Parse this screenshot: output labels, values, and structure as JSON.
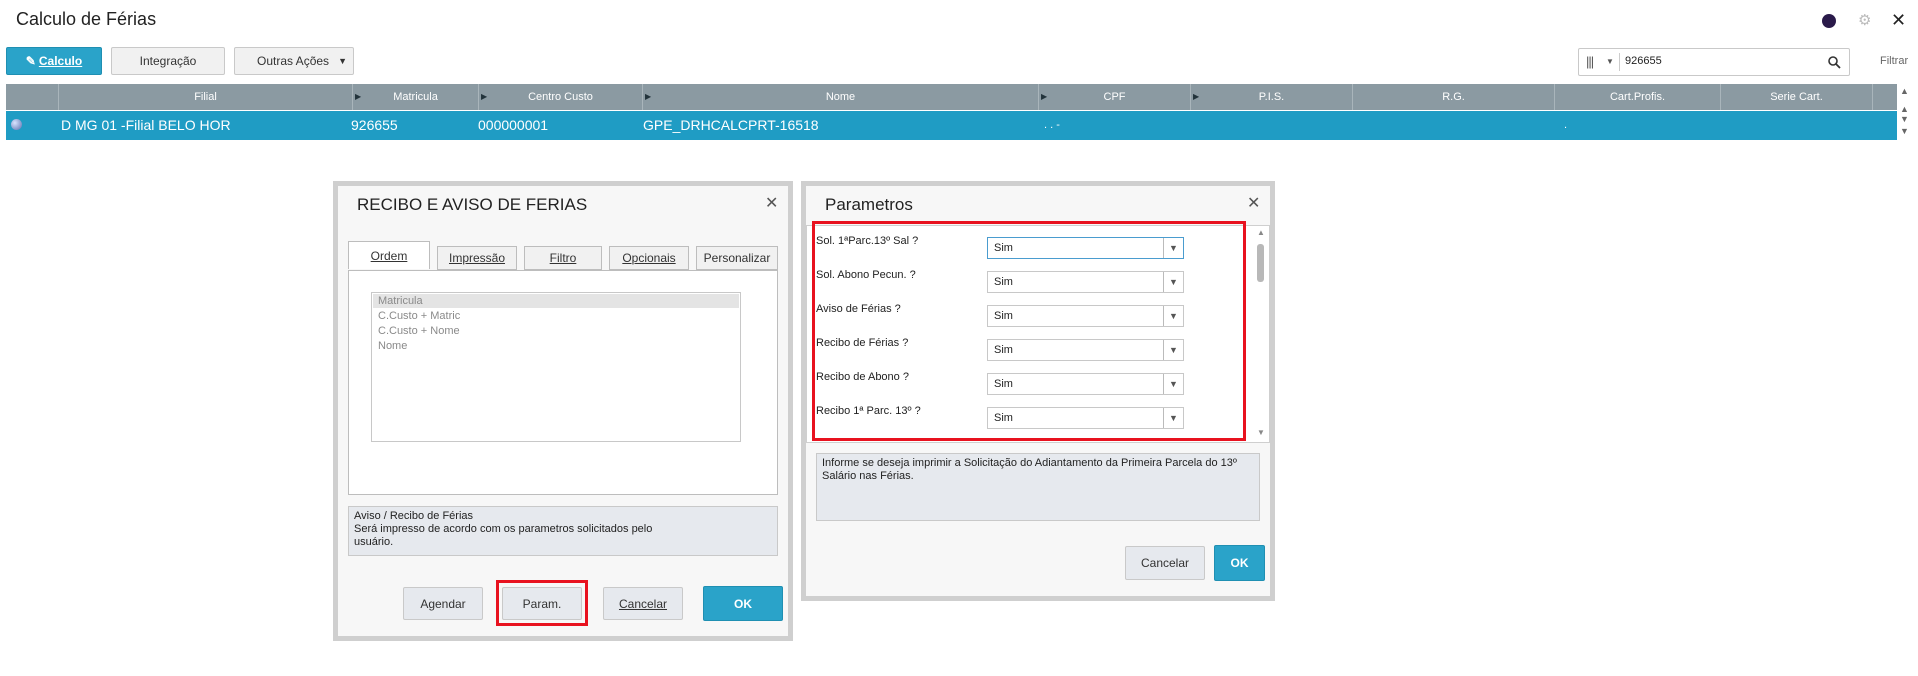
{
  "app": {
    "title": "Calculo de Férias"
  },
  "toolbar": {
    "calculo_label": "Calculo",
    "integracao_label": "Integração",
    "outras_acoes_label": "Outras Ações",
    "search_value": "926655",
    "filtrar_label": "Filtrar"
  },
  "grid": {
    "columns": [
      "Filial",
      "Matricula",
      "Centro Custo",
      "Nome",
      "CPF",
      "P.I.S.",
      "R.G.",
      "Cart.Profis.",
      "Serie Cart."
    ],
    "row": {
      "filial": "D MG 01 -Filial BELO HOR",
      "matricula": "926655",
      "centro_custo": "000000001",
      "nome": "GPE_DRHCALCPRT-16518",
      "cpf": ". . -",
      "cart_profis": "."
    }
  },
  "recibo_dialog": {
    "title": "RECIBO E AVISO DE FERIAS",
    "tabs": [
      "Ordem",
      "Impressão",
      "Filtro",
      "Opcionais",
      "Personalizar"
    ],
    "order_options": [
      "Matricula",
      "C.Custo + Matric",
      "C.Custo + Nome",
      "Nome"
    ],
    "info_title": "Aviso / Recibo de Férias",
    "info_line1": "Será impresso de acordo com os parametros solicitados pelo",
    "info_line2": "usuário.",
    "agendar_label": "Agendar",
    "param_label": "Param.",
    "cancelar_label": "Cancelar",
    "ok_label": "OK"
  },
  "param_dialog": {
    "title": "Parametros",
    "params": [
      {
        "label": "Sol. 1ªParc.13º Sal ?",
        "value": "Sim"
      },
      {
        "label": "Sol. Abono Pecun. ?",
        "value": "Sim"
      },
      {
        "label": "Aviso de Férias ?",
        "value": "Sim"
      },
      {
        "label": "Recibo de Férias ?",
        "value": "Sim"
      },
      {
        "label": "Recibo de Abono ?",
        "value": "Sim"
      },
      {
        "label": "Recibo 1ª Parc. 13º ?",
        "value": "Sim"
      }
    ],
    "help_line1": "Informe se deseja imprimir a Solicitação do Adiantamento da Primeira Parcela do 13º",
    "help_line2": "Salário nas Férias.",
    "cancelar_label": "Cancelar",
    "ok_label": "OK"
  },
  "colors": {
    "accent": "#2aa3c9",
    "highlight": "#e8121f",
    "row_selected": "#1f9cc4"
  }
}
